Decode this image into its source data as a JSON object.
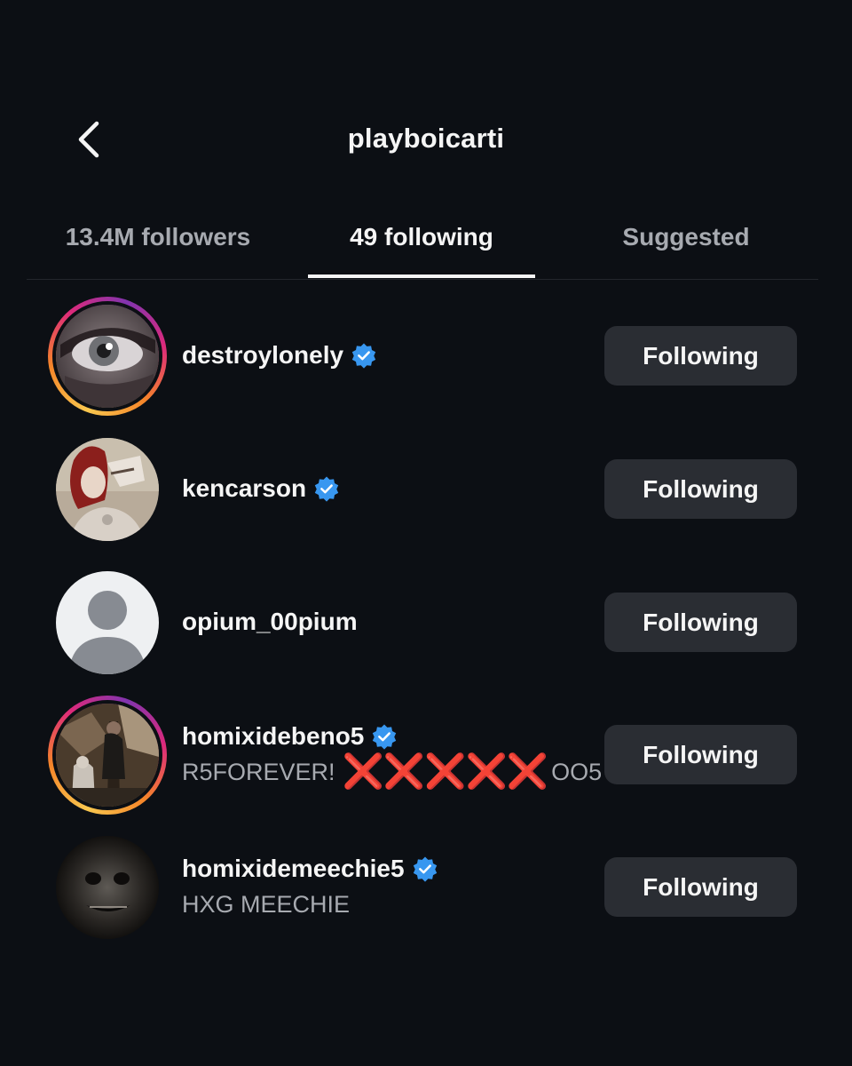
{
  "header": {
    "title": "playboicarti",
    "back_icon": "chevron-left-icon"
  },
  "tabs": [
    {
      "label": "13.4M followers",
      "active": false
    },
    {
      "label": "49 following",
      "active": true
    },
    {
      "label": "Suggested",
      "active": false
    }
  ],
  "list": [
    {
      "username": "destroylonely",
      "verified": true,
      "subtitle": "",
      "story_ring": true,
      "button_label": "Following"
    },
    {
      "username": "kencarson",
      "verified": true,
      "subtitle": "",
      "story_ring": false,
      "button_label": "Following"
    },
    {
      "username": "opium_00pium",
      "verified": false,
      "subtitle": "",
      "story_ring": false,
      "button_label": "Following"
    },
    {
      "username": "homixidebeno5",
      "verified": true,
      "subtitle_prefix": "R5FOREVER!",
      "subtitle_marks": "❌❌❌❌❌",
      "subtitle_suffix": "OO5",
      "story_ring": true,
      "button_label": "Following"
    },
    {
      "username": "homixidemeechie5",
      "verified": true,
      "subtitle": "HXG MEECHIE",
      "story_ring": false,
      "button_label": "Following"
    }
  ],
  "colors": {
    "background": "#0c0f14",
    "button": "#2a2d33",
    "verified_blue": "#3897f0",
    "secondary_text": "#a7aab0",
    "x_mark_red": "#e0201b"
  }
}
